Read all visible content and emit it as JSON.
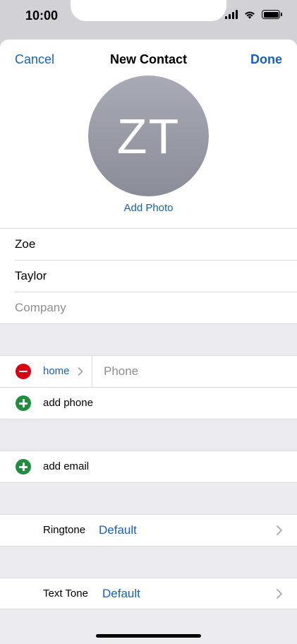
{
  "status": {
    "time": "10:00"
  },
  "nav": {
    "cancel": "Cancel",
    "title": "New Contact",
    "done": "Done"
  },
  "avatar": {
    "initials": "ZT",
    "add_photo": "Add Photo"
  },
  "name_fields": {
    "first_name": "Zoe",
    "last_name": "Taylor",
    "company_placeholder": "Company"
  },
  "phone": {
    "label": "home",
    "placeholder": "Phone",
    "add_label": "add phone"
  },
  "email": {
    "add_label": "add email"
  },
  "ringtone": {
    "label": "Ringtone",
    "value": "Default"
  },
  "text_tone": {
    "label": "Text Tone",
    "value": "Default"
  },
  "colors": {
    "accent": "#1761b7",
    "delete": "#d70015",
    "add": "#1e8e3e"
  }
}
